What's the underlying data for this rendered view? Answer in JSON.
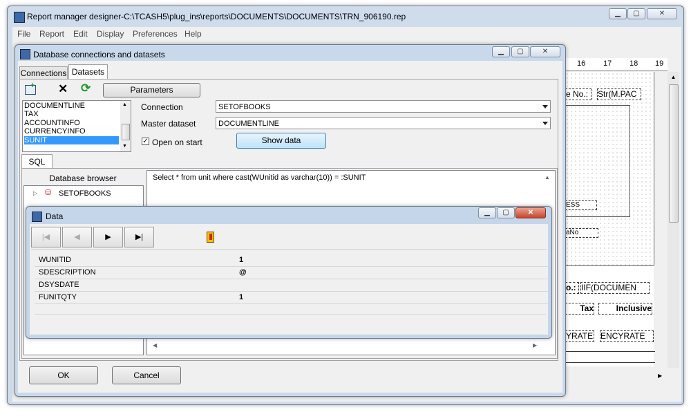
{
  "main_window": {
    "title": "Report manager designer-C:\\TCASH5\\plug_ins\\reports\\DOCUMENTS\\DOCUMENTS\\TRN_906190.rep",
    "menu": [
      "File",
      "Report",
      "Edit",
      "Display",
      "Preferences",
      "Help"
    ]
  },
  "ruler": {
    "marks": [
      "16",
      "17",
      "18",
      "19"
    ]
  },
  "designer_fields": {
    "f1": "e No.:",
    "f2": "Str(M.PAC",
    "f3": "ESS",
    "f4": "aNo",
    "f5": "o.:",
    "f6": "IIF(DOCUMEN",
    "f7": "Tax",
    "f8": "Inclusive",
    "f9": "YRATE",
    "f10": "ENCYRATE"
  },
  "db_dialog": {
    "title": "Database connections and datasets",
    "tabs": [
      "Connections",
      "Datasets"
    ],
    "parameters_label": "Parameters",
    "datasets": [
      "DOCUMENTLINE",
      "TAX",
      "ACCOUNTINFO",
      "CURRENCYINFO",
      "SUNIT"
    ],
    "selected_dataset": "SUNIT",
    "connection_label": "Connection",
    "connection_value": "SETOFBOOKS",
    "master_label": "Master dataset",
    "master_value": "DOCUMENTLINE",
    "open_on_start_label": "Open on start",
    "open_on_start_checked": true,
    "show_data_label": "Show data",
    "sql_tab": "SQL",
    "browser_title": "Database browser",
    "browser_node": "SETOFBOOKS",
    "sql_text": "Select * from unit where cast(WUnitid as varchar(10)) = :SUNIT",
    "ok_label": "OK",
    "cancel_label": "Cancel"
  },
  "data_window": {
    "title": "Data",
    "fields": [
      {
        "name": "WUNITID",
        "value": "1"
      },
      {
        "name": "SDESCRIPTION",
        "value": "@"
      },
      {
        "name": "DSYSDATE",
        "value": ""
      },
      {
        "name": "FUNITQTY",
        "value": "1"
      }
    ]
  }
}
